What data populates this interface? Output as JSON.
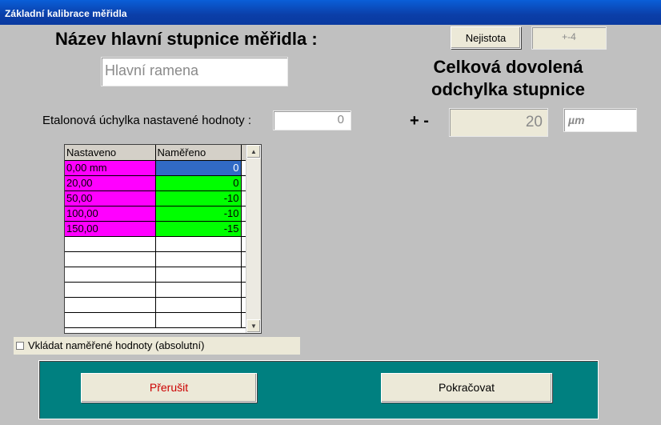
{
  "window": {
    "title": "Základní kalibrace měřidla"
  },
  "header": {
    "scale_name_label": "Název hlavní stupnice měřidla :"
  },
  "scale_name_input": {
    "value": "Hlavní ramena"
  },
  "uncertainty": {
    "button_label": "Nejistota",
    "value": "+-4"
  },
  "tolerance": {
    "label_line1": "Celková dovolená",
    "label_line2": "odchylka stupnice",
    "plus_minus": "+ -",
    "value": "20",
    "unit": "µm"
  },
  "etalon": {
    "label": "Etalonová úchylka nastavené hodnoty :",
    "value": "0"
  },
  "grid": {
    "columns": [
      "Nastaveno",
      "Naměřeno"
    ],
    "rows": [
      {
        "set": "0,00 mm",
        "measured": "0"
      },
      {
        "set": "20,00",
        "measured": "0"
      },
      {
        "set": "50,00",
        "measured": "-10"
      },
      {
        "set": "100,00",
        "measured": "-10"
      },
      {
        "set": "150,00",
        "measured": "-15"
      },
      {
        "set": "",
        "measured": ""
      },
      {
        "set": "",
        "measured": ""
      },
      {
        "set": "",
        "measured": ""
      },
      {
        "set": "",
        "measured": ""
      },
      {
        "set": "",
        "measured": ""
      },
      {
        "set": "",
        "measured": ""
      }
    ]
  },
  "checkbox": {
    "label": "Vkládat naměřené hodnoty (absolutní)",
    "checked": false
  },
  "buttons": {
    "cancel": "Přerušit",
    "continue": "Pokračovat"
  },
  "colors": {
    "set_cell": "#ff00ff",
    "measured_cell": "#00ff00",
    "selected_cell": "#316ac5",
    "panel": "#008080"
  }
}
